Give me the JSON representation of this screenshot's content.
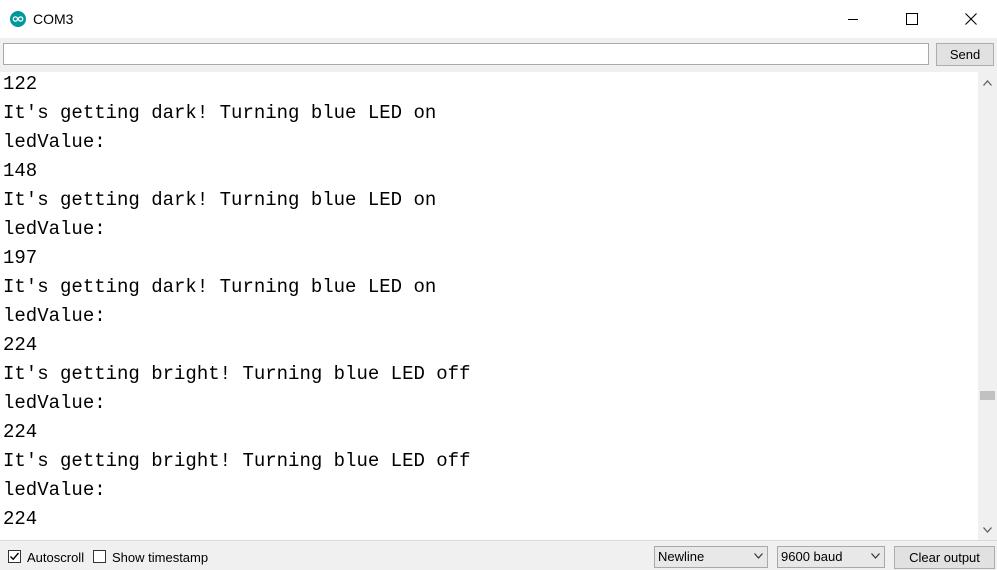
{
  "window": {
    "title": "COM3",
    "icon": "arduino-icon"
  },
  "send_bar": {
    "input_value": "",
    "send_label": "Send"
  },
  "output_lines": [
    "122",
    "It's getting dark! Turning blue LED on",
    "ledValue:",
    "148",
    "It's getting dark! Turning blue LED on",
    "ledValue:",
    "197",
    "It's getting dark! Turning blue LED on",
    "ledValue:",
    "224",
    "It's getting bright! Turning blue LED off",
    "ledValue:",
    "224",
    "It's getting bright! Turning blue LED off",
    "ledValue:",
    "224"
  ],
  "status_bar": {
    "autoscroll_label": "Autoscroll",
    "autoscroll_checked": true,
    "timestamp_label": "Show timestamp",
    "timestamp_checked": false,
    "line_ending": "Newline",
    "baud_rate": "9600 baud",
    "clear_label": "Clear output"
  },
  "colors": {
    "accent": "#00979d"
  }
}
